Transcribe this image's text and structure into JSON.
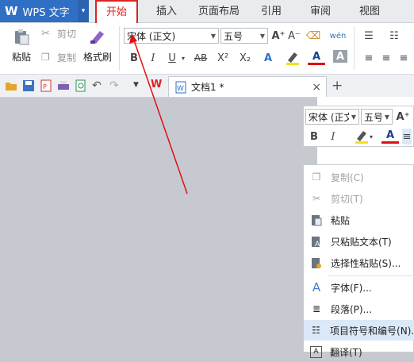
{
  "app": {
    "name": "WPS 文字",
    "menu_arrow": "▾"
  },
  "tabs": [
    "开始",
    "插入",
    "页面布局",
    "引用",
    "审阅",
    "视图"
  ],
  "ribbon": {
    "paste": "粘贴",
    "cut": "剪切",
    "copy": "复制",
    "format_painter": "格式刷",
    "font": "宋体 (正文)",
    "size": "五号",
    "bold": "B",
    "italic": "I",
    "underline": "U",
    "strike": "AB",
    "superscript": "X²",
    "subscript": "X₂",
    "font_color_letter": "A",
    "grow": "A⁺",
    "shrink": "A⁻",
    "pinyin": "wén"
  },
  "quick": {
    "doc_title": "文档1 *",
    "close": "×",
    "new_tab": "+"
  },
  "mini_toolbar": {
    "font": "宋体 (正文",
    "size": "五号"
  },
  "context_menu": [
    {
      "label": "复制(C)",
      "icon": "copy-icon",
      "disabled": true
    },
    {
      "label": "剪切(T)",
      "icon": "scissors-icon",
      "disabled": true
    },
    {
      "label": "粘贴",
      "icon": "paste-icon",
      "disabled": false
    },
    {
      "label": "只粘贴文本(T)",
      "icon": "paste-text-icon",
      "disabled": false
    },
    {
      "label": "选择性粘贴(S)...",
      "icon": "paste-special-icon",
      "disabled": false
    },
    {
      "label": "字体(F)...",
      "icon": "font-icon",
      "disabled": false
    },
    {
      "label": "段落(P)...",
      "icon": "paragraph-icon",
      "disabled": false
    },
    {
      "label": "项目符号和编号(N)...",
      "icon": "bullets-icon",
      "disabled": false,
      "highlighted": true
    },
    {
      "label": "翻译(T)",
      "icon": "translate-icon",
      "disabled": false
    }
  ],
  "colors": {
    "accent": "#2f6fc4",
    "annotation": "#dd1111",
    "highlight": "#dbe8f7"
  }
}
